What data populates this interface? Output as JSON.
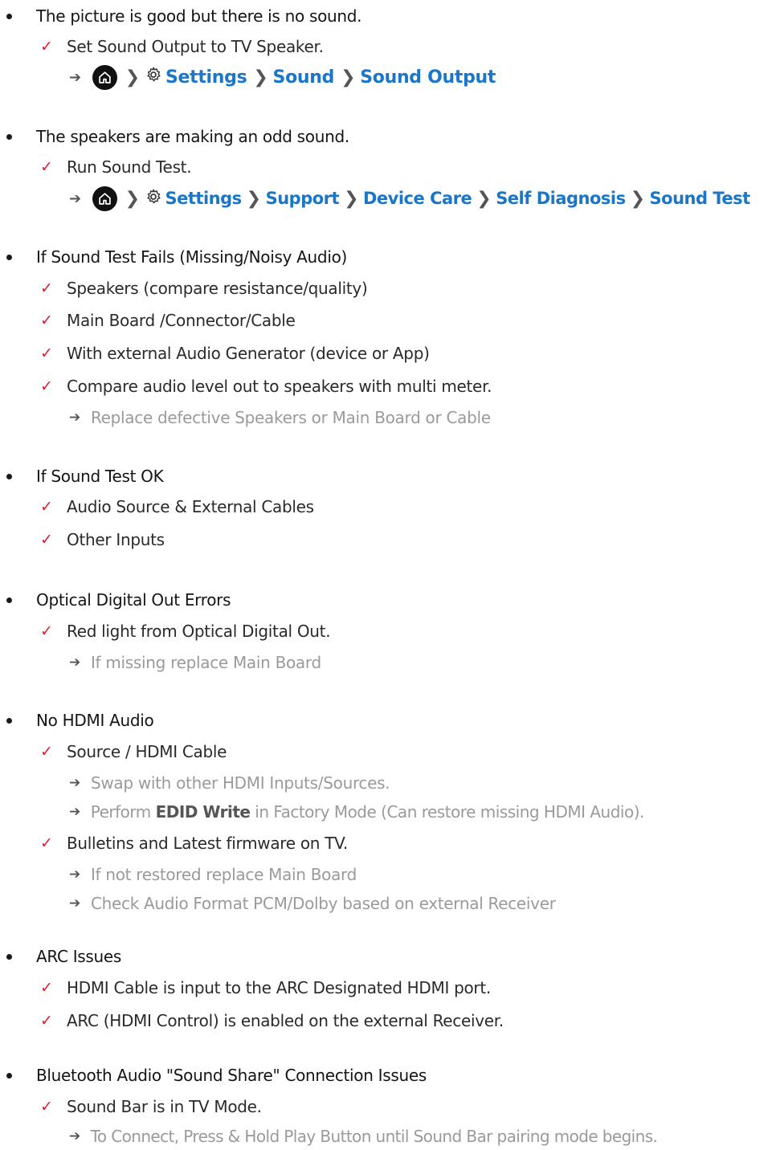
{
  "sections": [
    {
      "heading": "The picture is good but there is no sound.",
      "check": "Set Sound Output to TV Speaker.",
      "path": [
        "Settings",
        "Sound",
        "Sound Output"
      ]
    },
    {
      "heading": "The speakers are making an odd sound.",
      "check": "Run Sound Test.",
      "path": [
        "Settings",
        "Support",
        "Device Care",
        "Self Diagnosis",
        "Sound Test"
      ]
    },
    {
      "heading": "If Sound Test Fails (Missing/Noisy Audio)",
      "checks": [
        "Speakers (compare resistance/quality)",
        "Main Board /Connector/Cable",
        "With external Audio Generator (device or App)",
        "Compare audio level out to speakers with multi meter."
      ],
      "note": "Replace defective Speakers or Main Board or Cable"
    },
    {
      "heading": "If Sound Test OK",
      "checks": [
        "Audio Source & External Cables",
        "Other Inputs"
      ]
    },
    {
      "heading": "Optical Digital Out Errors",
      "check": "Red light from Optical Digital Out.",
      "note": "If missing replace Main Board"
    },
    {
      "heading": "No HDMI Audio",
      "check1": "Source / HDMI Cable",
      "note1": "Swap with other HDMI Inputs/Sources.",
      "note2_pre": "Perform ",
      "note2_strong": "EDID Write",
      "note2_post": " in Factory Mode (Can restore missing HDMI Audio).",
      "check2": "Bulletins and Latest firmware on TV.",
      "note3": "If not restored replace Main Board",
      "note4": "Check Audio Format PCM/Dolby based on external Receiver"
    },
    {
      "heading": "ARC Issues",
      "checks": [
        "HDMI Cable is input to the ARC Designated HDMI port.",
        "ARC (HDMI Control) is enabled on the external Receiver."
      ]
    },
    {
      "heading": "Bluetooth Audio \"Sound Share\" Connection Issues",
      "check": "Sound Bar is in TV Mode.",
      "note": "To Connect, Press & Hold Play Button until Sound Bar pairing mode begins."
    }
  ],
  "colors": {
    "link": "#1a76c9",
    "check": "#e0202f",
    "note": "#9a9a9a"
  },
  "icons": {
    "home": "home-icon",
    "settings": "gear-icon",
    "separator": "chevron-right-icon",
    "check": "checkmark-icon",
    "arrow": "arrow-right-icon"
  }
}
